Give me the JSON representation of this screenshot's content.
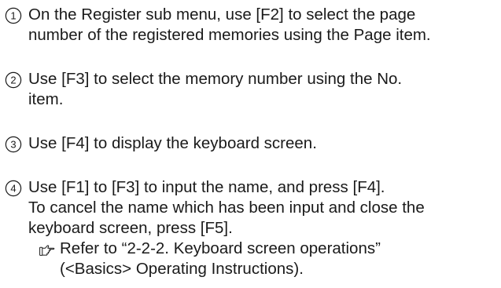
{
  "steps": [
    {
      "number": "1",
      "lines": [
        "On the Register sub menu, use [F2] to select the page",
        "number of the registered memories using the Page item."
      ]
    },
    {
      "number": "2",
      "lines": [
        "Use [F3] to select the memory number using the No.",
        "item."
      ]
    },
    {
      "number": "3",
      "lines": [
        "Use [F4] to display the keyboard screen."
      ]
    },
    {
      "number": "4",
      "lines": [
        "Use [F1] to [F3] to input the name, and press [F4].",
        "To cancel the name which has been input and close the",
        "keyboard screen, press [F5]."
      ],
      "note": {
        "icon": "pointing-hand-icon",
        "lines": [
          "Refer to “2-2-2. Keyboard screen operations”",
          "(<Basics> Operating Instructions)."
        ]
      }
    }
  ]
}
